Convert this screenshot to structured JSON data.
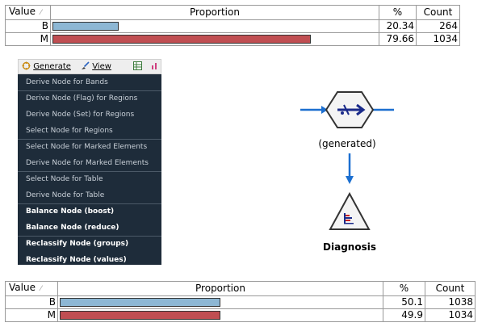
{
  "top_table": {
    "columns": {
      "value": "Value",
      "proportion": "Proportion",
      "percent": "%",
      "count": "Count"
    },
    "rows": [
      {
        "value": "B",
        "percent": "20.34",
        "count": "264",
        "proportion": 0.2034,
        "color": "#8db7d4"
      },
      {
        "value": "M",
        "percent": "79.66",
        "count": "1034",
        "proportion": 0.7966,
        "color": "#c04e52"
      }
    ]
  },
  "toolbar": {
    "generate_label": "Generate",
    "view_label": "View"
  },
  "menu": {
    "items": [
      {
        "label": "Derive Node for Bands",
        "bold": false
      },
      {
        "label": "Derive Node (Flag) for Regions",
        "bold": false
      },
      {
        "label": "Derive Node (Set) for Regions",
        "bold": false
      },
      {
        "label": "Select Node for Regions",
        "bold": false
      },
      {
        "label": "Select Node for Marked Elements",
        "bold": false
      },
      {
        "label": "Derive Node for Marked Elements",
        "bold": false
      },
      {
        "label": "Select Node for Table",
        "bold": false
      },
      {
        "label": "Derive Node for Table",
        "bold": false
      },
      {
        "label": "Balance Node (boost)",
        "bold": true
      },
      {
        "label": "Balance Node (reduce)",
        "bold": true
      },
      {
        "label": "Reclassify Node (groups)",
        "bold": true
      },
      {
        "label": "Reclassify Node (values)",
        "bold": true
      }
    ]
  },
  "flow": {
    "generated_label": "(generated)",
    "diagnosis_label": "Diagnosis",
    "accent_color": "#1c6fd0"
  },
  "bottom_table": {
    "columns": {
      "value": "Value",
      "proportion": "Proportion",
      "percent": "%",
      "count": "Count"
    },
    "rows": [
      {
        "value": "B",
        "percent": "50.1",
        "count": "1038",
        "proportion": 0.501,
        "color": "#8db7d4"
      },
      {
        "value": "M",
        "percent": "49.9",
        "count": "1034",
        "proportion": 0.499,
        "color": "#c04e52"
      }
    ]
  }
}
